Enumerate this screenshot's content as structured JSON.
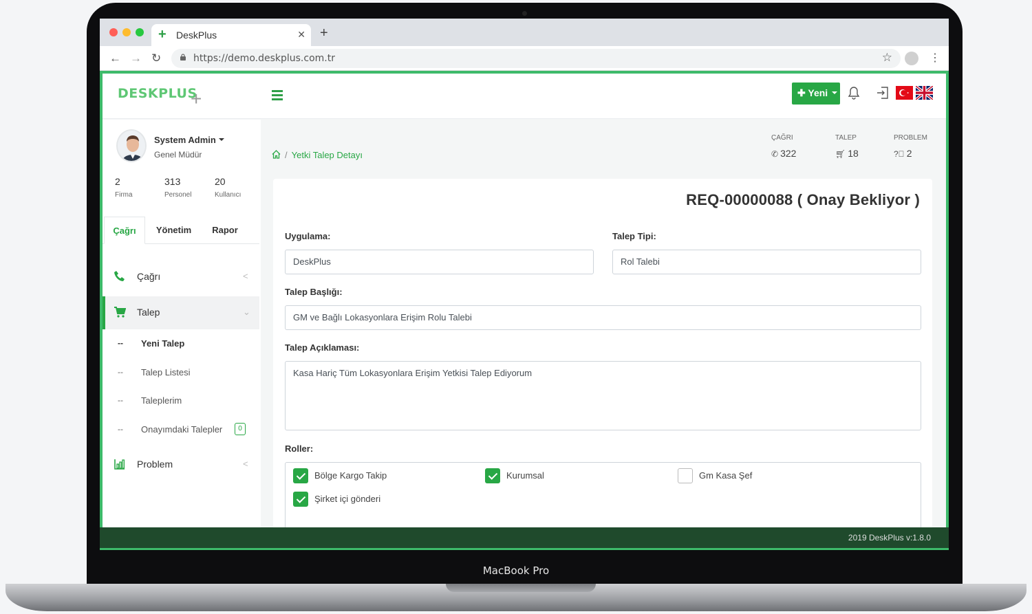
{
  "device": {
    "label": "MacBook Pro"
  },
  "browser": {
    "tab_title": "DeskPlus",
    "url": "https://demo.deskplus.com.tr"
  },
  "app": {
    "logo": {
      "text": "DESKPLUS",
      "plus": "+"
    },
    "new_button_label": "Yeni",
    "user": {
      "name": "System Admin",
      "role": "Genel Müdür"
    },
    "stats": [
      {
        "value": "2",
        "label": "Firma"
      },
      {
        "value": "313",
        "label": "Personel"
      },
      {
        "value": "20",
        "label": "Kullanıcı"
      }
    ],
    "sidebar_tabs": [
      "Çağrı",
      "Yönetim",
      "Rapor"
    ],
    "menu": {
      "cagri": "Çağrı",
      "talep": "Talep",
      "problem": "Problem",
      "sub_items": [
        {
          "label": "Yeni Talep",
          "dash": "--"
        },
        {
          "label": "Talep Listesi",
          "dash": "--"
        },
        {
          "label": "Taleplerim",
          "dash": "--"
        },
        {
          "label": "Onayımdaki Talepler",
          "dash": "--",
          "badge": "0"
        }
      ]
    },
    "breadcrumb": {
      "separator": "/",
      "current": "Yetki Talep Detayı"
    },
    "counters": [
      {
        "label": "ÇAĞRI",
        "value": "322"
      },
      {
        "label": "TALEP",
        "value": "18"
      },
      {
        "label": "PROBLEM",
        "value": "2"
      }
    ],
    "request": {
      "title": "REQ-00000088 ( Onay Bekliyor )",
      "application_label": "Uygulama:",
      "application_value": "DeskPlus",
      "type_label": "Talep Tipi:",
      "type_value": "Rol Talebi",
      "subject_label": "Talep Başlığı:",
      "subject_value": "GM ve Bağlı Lokasyonlara Erişim Rolu Talebi",
      "description_label": "Talep Açıklaması:",
      "description_value": "Kasa Hariç Tüm Lokasyonlara Erişim Yetkisi Talep Ediyorum",
      "roles_label": "Roller:",
      "roles": [
        {
          "label": "Bölge Kargo Takip",
          "checked": true
        },
        {
          "label": "Kurumsal",
          "checked": true
        },
        {
          "label": "Gm Kasa Şef",
          "checked": false
        },
        {
          "label": "Şirket içi gönderi",
          "checked": true
        }
      ]
    },
    "footer": "2019 DeskPlus v:1.8.0"
  },
  "colors": {
    "accent": "#28a745",
    "frame_green": "#3dba6a",
    "footer_bg": "#1f4a2c"
  }
}
